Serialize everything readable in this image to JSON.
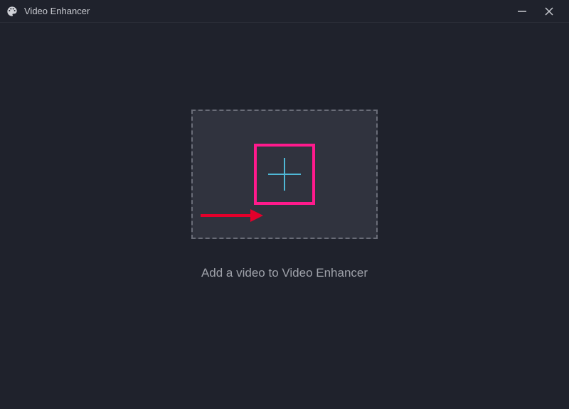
{
  "titlebar": {
    "app_name": "Video Enhancer"
  },
  "main": {
    "instruction_text": "Add a video to Video Enhancer"
  },
  "icons": {
    "app_icon": "palette-icon",
    "minimize": "minimize-icon",
    "close": "close-icon",
    "add": "plus-icon"
  },
  "colors": {
    "accent_plus": "#4fb8d6",
    "highlight_box": "#ff1a8c",
    "annotation_arrow": "#e4002b",
    "background": "#1f222c",
    "dropzone_bg": "#30333e"
  }
}
